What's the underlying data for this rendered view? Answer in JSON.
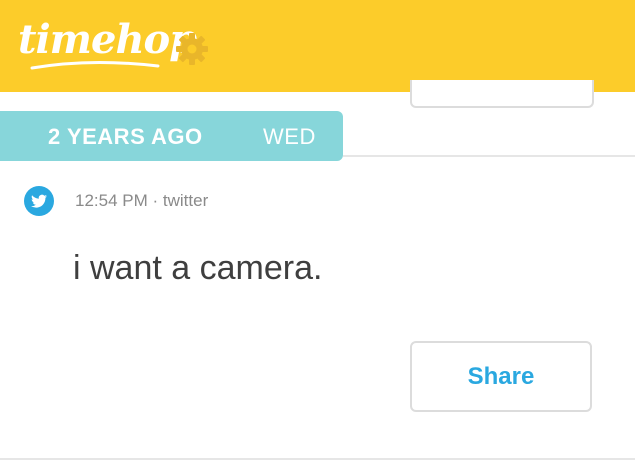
{
  "header": {
    "logo_text": "timehop",
    "settings_icon": "gear-icon",
    "background_color": "#fccc2a"
  },
  "date_strip": {
    "years_ago": "2 YEARS AGO",
    "weekday": "WED",
    "background_color": "#87d6da"
  },
  "post": {
    "source_icon": "twitter-bird-icon",
    "time": "12:54 PM",
    "separator": "·",
    "source": "twitter",
    "text": "i want a camera.",
    "share_label": "Share"
  },
  "colors": {
    "share_text": "#2aa8e0",
    "twitter_blue": "#2aa8e0"
  }
}
